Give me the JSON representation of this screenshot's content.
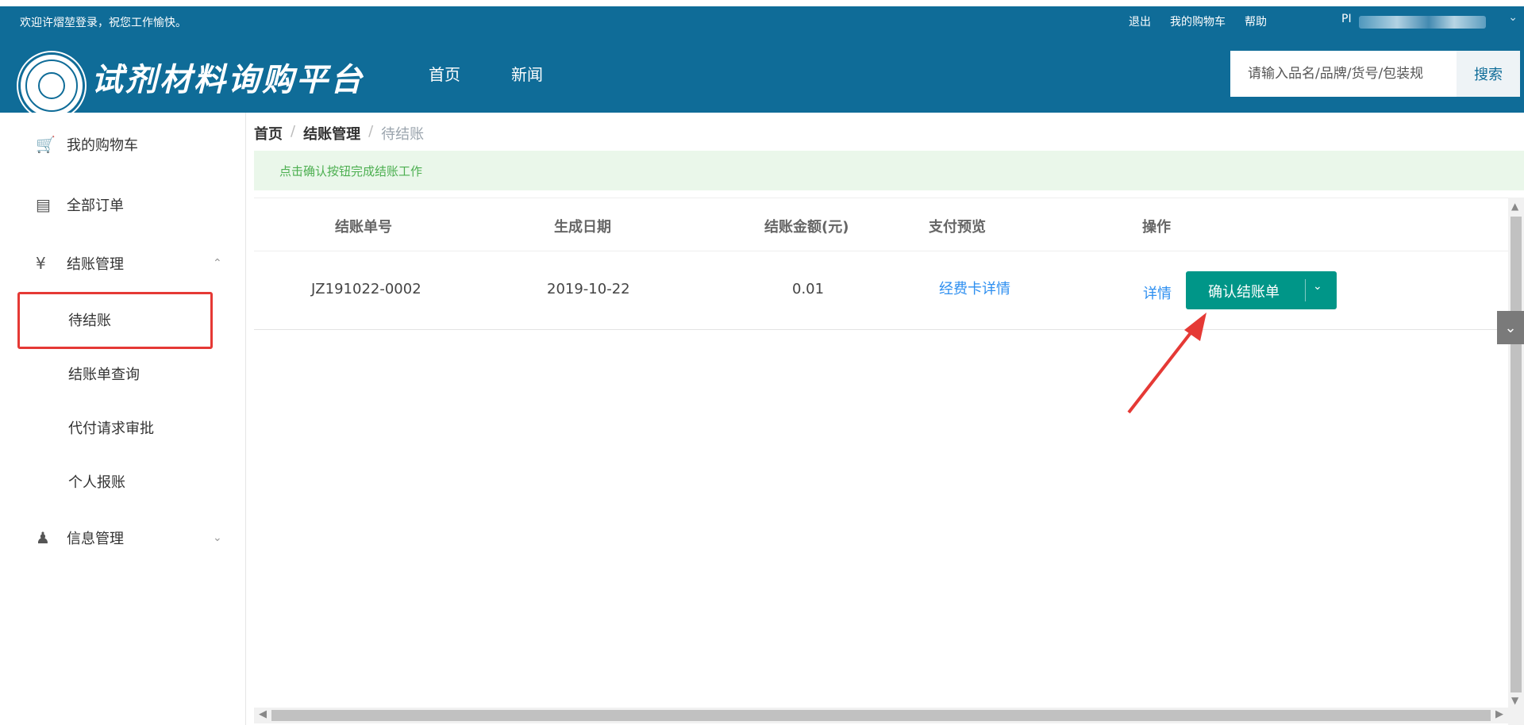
{
  "header": {
    "welcome": "欢迎许熠堃登录，祝您工作愉快。",
    "links": [
      "退出",
      "我的购物车",
      "帮助"
    ],
    "user": "PI",
    "title": "试剂材料询购平台",
    "nav": [
      "首页",
      "新闻"
    ],
    "search_placeholder": "请输入品名/品牌/货号/包装规",
    "search_button": "搜索"
  },
  "sidebar": {
    "items": [
      {
        "icon": "cart-icon",
        "label": "我的购物车"
      },
      {
        "icon": "clipboard-icon",
        "label": "全部订单"
      },
      {
        "icon": "moneybag-icon",
        "label": "结账管理"
      },
      {
        "icon": "user-icon",
        "label": "信息管理"
      }
    ],
    "sub_items": [
      "待结账",
      "结账单查询",
      "代付请求审批",
      "个人报账"
    ]
  },
  "breadcrumb": [
    "首页",
    "结账管理",
    "待结账"
  ],
  "alert": "点击确认按钮完成结账工作",
  "table": {
    "headers": [
      "结账单号",
      "生成日期",
      "结账金额(元)",
      "支付预览",
      "操作"
    ],
    "rows": [
      {
        "id": "JZ191022-0002",
        "date": "2019-10-22",
        "amount": "0.01",
        "payment_preview": "经费卡详情",
        "detail_link": "详情",
        "confirm_button": "确认结账单"
      }
    ]
  },
  "colors": {
    "header_bg": "#0f6c98",
    "accent": "#009688",
    "link": "#2e8ff0",
    "highlight": "#e53935",
    "alert_text": "#4caf50"
  }
}
